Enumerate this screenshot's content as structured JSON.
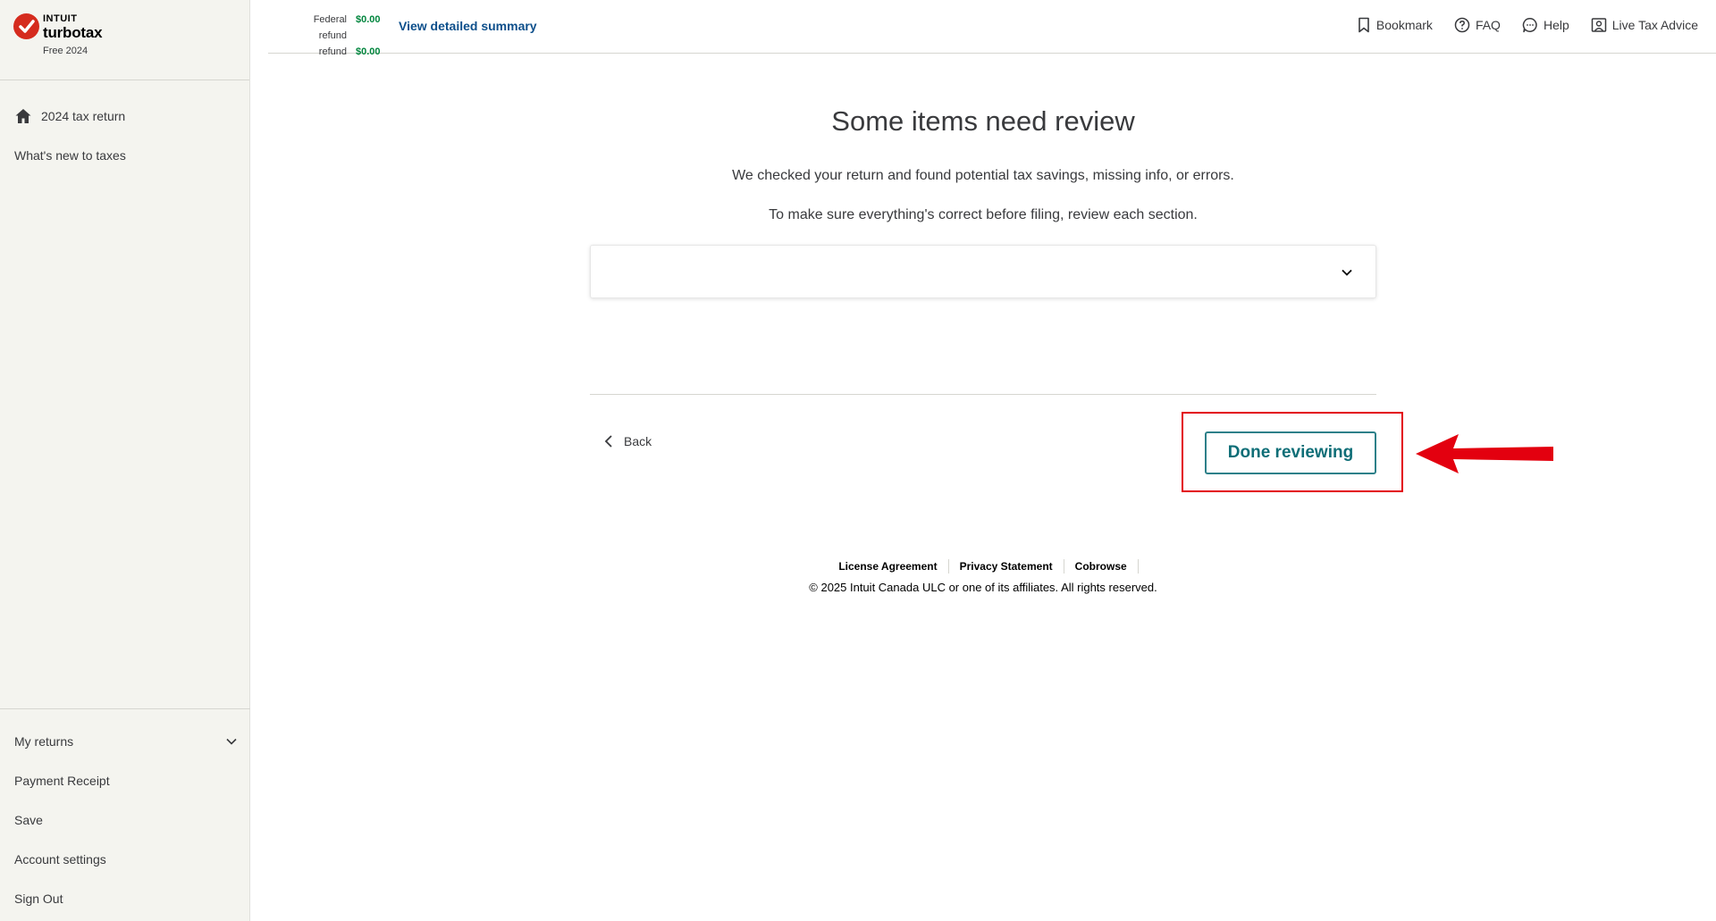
{
  "brand": {
    "company": "INTUIT",
    "product": "turbotax",
    "edition": "Free 2024",
    "logo_color": "#d52b1e"
  },
  "sidebar": {
    "top_items": [
      {
        "label": "2024 tax return",
        "icon": "home-icon"
      },
      {
        "label": "What's new to taxes"
      }
    ],
    "bottom_items": [
      {
        "label": "My returns",
        "icon": "chevron-down-icon"
      },
      {
        "label": "Payment Receipt"
      },
      {
        "label": "Save"
      },
      {
        "label": "Account settings"
      },
      {
        "label": "Sign Out"
      }
    ]
  },
  "header": {
    "refunds": [
      {
        "label": "Federal refund",
        "amount": "$0.00"
      },
      {
        "label": "refund",
        "amount": "$0.00"
      }
    ],
    "summary_link": "View detailed summary",
    "links": [
      {
        "label": "Bookmark",
        "icon": "bookmark-icon"
      },
      {
        "label": "FAQ",
        "icon": "question-icon"
      },
      {
        "label": "Help",
        "icon": "chat-icon"
      },
      {
        "label": "Live Tax Advice",
        "icon": "person-icon"
      }
    ]
  },
  "main": {
    "title": "Some items need review",
    "paragraph1": "We checked your return and found potential tax savings, missing info, or errors.",
    "paragraph2": "To make sure everything's correct before filing, review each section.",
    "back_label": "Back",
    "done_label": "Done reviewing"
  },
  "footer": {
    "links": [
      "License Agreement",
      "Privacy Statement",
      "Cobrowse"
    ],
    "copyright": "© 2025 Intuit Canada ULC or one of its affiliates. All rights reserved."
  },
  "colors": {
    "accent_teal": "#0e6e77",
    "refund_green": "#00853d",
    "link_blue": "#0d4f8b",
    "annotation_red": "#e3000f"
  }
}
